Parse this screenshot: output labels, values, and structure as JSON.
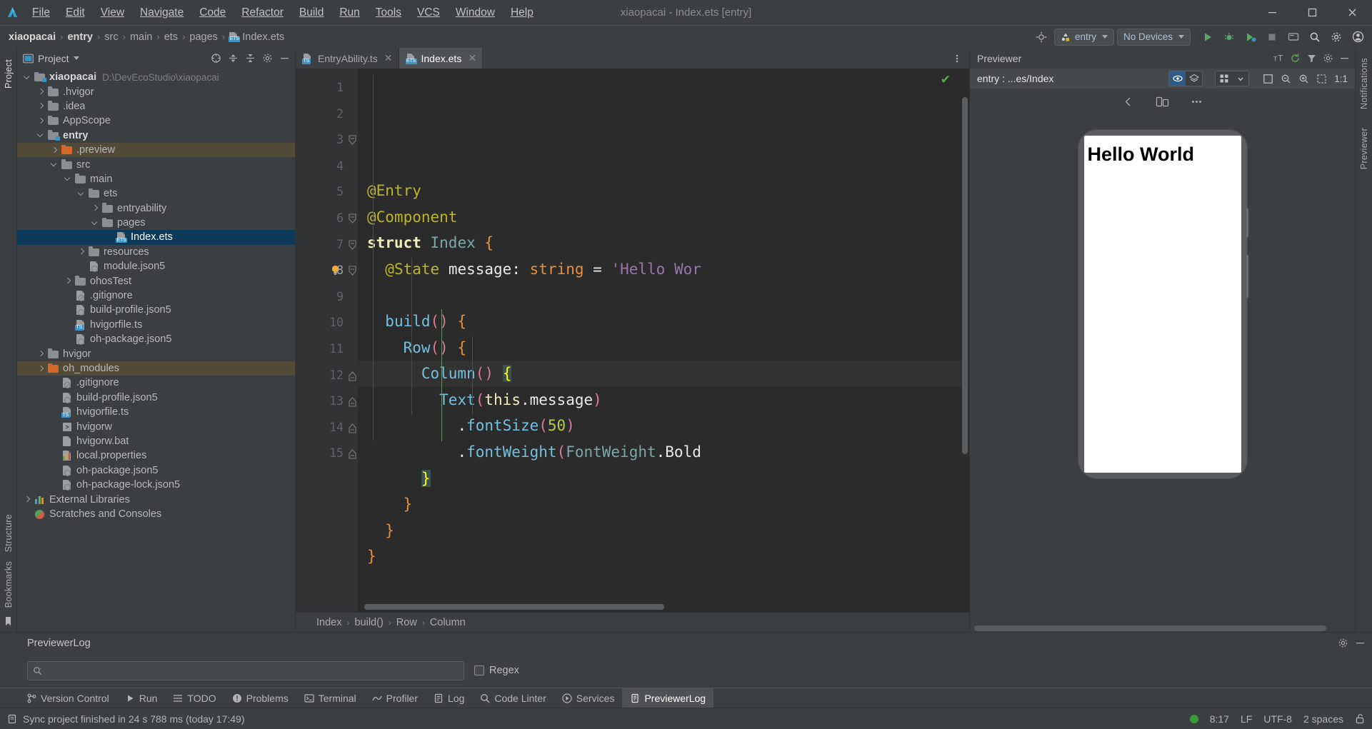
{
  "window": {
    "title": "xiaopacai - Index.ets [entry]",
    "minimize_label": "–",
    "maximize_label": "☐",
    "close_label": "✕"
  },
  "menu": {
    "items": [
      {
        "label": "File",
        "mnemonic": "F"
      },
      {
        "label": "Edit",
        "mnemonic": "E"
      },
      {
        "label": "View",
        "mnemonic": "V"
      },
      {
        "label": "Navigate",
        "mnemonic": "N"
      },
      {
        "label": "Code",
        "mnemonic": "C"
      },
      {
        "label": "Refactor",
        "mnemonic": "R"
      },
      {
        "label": "Build",
        "mnemonic": "B"
      },
      {
        "label": "Run",
        "mnemonic": "u"
      },
      {
        "label": "Tools",
        "mnemonic": "T"
      },
      {
        "label": "VCS",
        "mnemonic": "S"
      },
      {
        "label": "Window",
        "mnemonic": "W"
      },
      {
        "label": "Help",
        "mnemonic": "H"
      }
    ]
  },
  "breadcrumb": {
    "items": [
      "xiaopacai",
      "entry",
      "src",
      "main",
      "ets",
      "pages",
      "Index.ets"
    ],
    "separator": "›"
  },
  "toolbar": {
    "target_icon": "target-icon",
    "module_selector": "entry",
    "device_selector": "No Devices",
    "run_label": "run-icon",
    "debug_label": "debug-icon",
    "profile_label": "profile-icon",
    "stop_label": "stop-icon",
    "device_manager_label": "device-manager-icon",
    "search_label": "search-icon",
    "settings_label": "settings-icon",
    "account_label": "account-icon"
  },
  "project_panel": {
    "title": "Project",
    "actions": [
      "select-opened-file-icon",
      "collapse-all-icon",
      "expand-all-icon",
      "settings-icon",
      "hide-icon"
    ],
    "tree": [
      {
        "label": "xiaopacai",
        "path": "D:\\DevEcoStudio\\xiaopacai",
        "indent": 0,
        "arrow": "open",
        "icon": "module-folder",
        "bold": true
      },
      {
        "label": ".hvigor",
        "indent": 1,
        "arrow": "closed",
        "icon": "folder"
      },
      {
        "label": ".idea",
        "indent": 1,
        "arrow": "closed",
        "icon": "folder"
      },
      {
        "label": "AppScope",
        "indent": 1,
        "arrow": "closed",
        "icon": "folder"
      },
      {
        "label": "entry",
        "indent": 1,
        "arrow": "open",
        "icon": "module-folder",
        "bold": true
      },
      {
        "label": ".preview",
        "indent": 2,
        "arrow": "closed",
        "icon": "folder-orange",
        "highlight": true
      },
      {
        "label": "src",
        "indent": 2,
        "arrow": "open",
        "icon": "folder"
      },
      {
        "label": "main",
        "indent": 3,
        "arrow": "open",
        "icon": "folder"
      },
      {
        "label": "ets",
        "indent": 4,
        "arrow": "open",
        "icon": "folder"
      },
      {
        "label": "entryability",
        "indent": 5,
        "arrow": "closed",
        "icon": "folder"
      },
      {
        "label": "pages",
        "indent": 5,
        "arrow": "open",
        "icon": "folder"
      },
      {
        "label": "Index.ets",
        "indent": 6,
        "arrow": "none",
        "icon": "ets-file",
        "selected": true
      },
      {
        "label": "resources",
        "indent": 4,
        "arrow": "closed",
        "icon": "folder"
      },
      {
        "label": "module.json5",
        "indent": 4,
        "arrow": "none",
        "icon": "json5-file"
      },
      {
        "label": "ohosTest",
        "indent": 3,
        "arrow": "closed",
        "icon": "folder"
      },
      {
        "label": ".gitignore",
        "indent": 3,
        "arrow": "none",
        "icon": "gitignore-file"
      },
      {
        "label": "build-profile.json5",
        "indent": 3,
        "arrow": "none",
        "icon": "json5-file"
      },
      {
        "label": "hvigorfile.ts",
        "indent": 3,
        "arrow": "none",
        "icon": "ts-file"
      },
      {
        "label": "oh-package.json5",
        "indent": 3,
        "arrow": "none",
        "icon": "json5-file"
      },
      {
        "label": "hvigor",
        "indent": 1,
        "arrow": "closed",
        "icon": "folder"
      },
      {
        "label": "oh_modules",
        "indent": 1,
        "arrow": "closed",
        "icon": "folder-orange",
        "highlight": true
      },
      {
        "label": ".gitignore",
        "indent": 2,
        "arrow": "none",
        "icon": "gitignore-file"
      },
      {
        "label": "build-profile.json5",
        "indent": 2,
        "arrow": "none",
        "icon": "json5-file"
      },
      {
        "label": "hvigorfile.ts",
        "indent": 2,
        "arrow": "none",
        "icon": "ts-file"
      },
      {
        "label": "hvigorw",
        "indent": 2,
        "arrow": "none",
        "icon": "shell-file"
      },
      {
        "label": "hvigorw.bat",
        "indent": 2,
        "arrow": "none",
        "icon": "bat-file"
      },
      {
        "label": "local.properties",
        "indent": 2,
        "arrow": "none",
        "icon": "properties-file"
      },
      {
        "label": "oh-package.json5",
        "indent": 2,
        "arrow": "none",
        "icon": "json5-file"
      },
      {
        "label": "oh-package-lock.json5",
        "indent": 2,
        "arrow": "none",
        "icon": "json5-file"
      },
      {
        "label": "External Libraries",
        "indent": 0,
        "arrow": "closed",
        "icon": "library"
      },
      {
        "label": "Scratches and Consoles",
        "indent": 0,
        "arrow": "none",
        "icon": "scratches"
      }
    ]
  },
  "editor": {
    "tabs": [
      {
        "label": "EntryAbility.ts",
        "icon": "ts-file",
        "active": false,
        "close": "✕"
      },
      {
        "label": "Index.ets",
        "icon": "ets-file",
        "active": true,
        "close": "✕"
      }
    ],
    "more_label": "more-options-icon",
    "inspection_status": "✔",
    "bulb_line": 8,
    "lines": [
      {
        "n": "1",
        "text": "@Entry",
        "fold": false
      },
      {
        "n": "2",
        "text": "@Component",
        "fold": false
      },
      {
        "n": "3",
        "text": "struct Index {",
        "fold": true
      },
      {
        "n": "4",
        "text": "  @State message: string = 'Hello Wor",
        "fold": false
      },
      {
        "n": "5",
        "text": "",
        "fold": false
      },
      {
        "n": "6",
        "text": "  build() {",
        "fold": true
      },
      {
        "n": "7",
        "text": "    Row() {",
        "fold": true
      },
      {
        "n": "8",
        "text": "      Column() {",
        "fold": true,
        "current": true
      },
      {
        "n": "9",
        "text": "        Text(this.message)",
        "fold": false
      },
      {
        "n": "10",
        "text": "          .fontSize(50)",
        "fold": false
      },
      {
        "n": "11",
        "text": "          .fontWeight(FontWeight.Bold",
        "fold": false
      },
      {
        "n": "12",
        "text": "      }",
        "fold": true
      },
      {
        "n": "13",
        "text": "    }",
        "fold": true
      },
      {
        "n": "14",
        "text": "  }",
        "fold": true
      },
      {
        "n": "15",
        "text": "}",
        "fold": true
      }
    ],
    "structure_breadcrumb": [
      "Index",
      "build()",
      "Row",
      "Column"
    ],
    "structure_separator": "›"
  },
  "previewer": {
    "title": "Previewer",
    "subtitle": "entry : ...es/Index",
    "settings_label": "settings-icon",
    "hide_label": "hide-icon",
    "actions": [
      "font-size-icon",
      "refresh-icon",
      "filter-icon",
      "settings-icon",
      "minimize-icon"
    ],
    "view_toggle": [
      "eye-icon",
      "layers-icon"
    ],
    "grid_toggle": [
      "grid-icon",
      "chevron-down-icon"
    ],
    "zoom_actions": [
      "fit-icon",
      "zoom-out-icon",
      "zoom-in-icon",
      "select-icon"
    ],
    "zoom_ratio": "1:1",
    "nav_actions": [
      "back-icon",
      "rotate-icon",
      "more-icon"
    ],
    "device_text": "Hello World"
  },
  "bottom_panel": {
    "title": "PreviewerLog",
    "settings_label": "settings-icon",
    "hide_label": "hide-icon",
    "search_placeholder": "",
    "search_value": "",
    "search_icon": "search-icon",
    "regex_label": "Regex",
    "regex_checked": false
  },
  "toolwindow_bar": {
    "items": [
      {
        "label": "Version Control",
        "icon": "branch-icon",
        "active": false
      },
      {
        "label": "Run",
        "icon": "play-icon",
        "active": false
      },
      {
        "label": "TODO",
        "icon": "list-icon",
        "active": false
      },
      {
        "label": "Problems",
        "icon": "warning-icon",
        "active": false
      },
      {
        "label": "Terminal",
        "icon": "terminal-icon",
        "active": false
      },
      {
        "label": "Profiler",
        "icon": "profiler-icon",
        "active": false
      },
      {
        "label": "Log",
        "icon": "log-icon",
        "active": false
      },
      {
        "label": "Code Linter",
        "icon": "linter-icon",
        "active": false
      },
      {
        "label": "Services",
        "icon": "services-icon",
        "active": false
      },
      {
        "label": "PreviewerLog",
        "icon": "previewerlog-icon",
        "active": true
      }
    ]
  },
  "left_rail": {
    "top": [
      "Project"
    ],
    "bottom": [
      "Structure",
      "Bookmarks"
    ]
  },
  "right_rail": {
    "items": [
      "Notifications",
      "Previewer"
    ]
  },
  "statusbar": {
    "message_icon": "event-log-icon",
    "message": "Sync project finished in 24 s 788 ms (today 17:49)",
    "caret_position": "8:17",
    "line_separator": "LF",
    "encoding": "UTF-8",
    "indent": "2 spaces",
    "lock_icon": "unlocked-icon",
    "indicator_color": "#389b38"
  },
  "colors": {
    "accent": "#3592c4",
    "selection": "#0d3a58",
    "highlight_row": "#514b38",
    "editor_bg": "#2b2b2b",
    "panel_bg": "#3c3f41"
  }
}
